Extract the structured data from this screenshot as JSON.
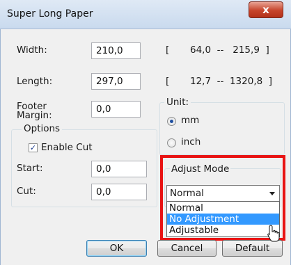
{
  "window": {
    "title": "Super Long Paper",
    "close_label": "x"
  },
  "fields": {
    "width": {
      "label": "Width:",
      "value": "210,0",
      "range_open": "[",
      "range_text": "64,0  --   215,9  ]"
    },
    "length": {
      "label": "Length:",
      "value": "297,0",
      "range_open": "[",
      "range_text": "12,7  --  1320,8  ]"
    },
    "footer_margin": {
      "label_line1": "Footer",
      "label_line2": "Margin:",
      "value": "0,0"
    }
  },
  "unit": {
    "title": "Unit:",
    "options": [
      "mm",
      "inch"
    ],
    "selected": "mm"
  },
  "options_group": {
    "title": "Options",
    "enable_cut_label": "Enable Cut",
    "enable_cut_checked": true,
    "check_mark": "✓",
    "start": {
      "label": "Start:",
      "value": "0,0"
    },
    "cut": {
      "label": "Cut:",
      "value": "0,0"
    }
  },
  "adjust_mode": {
    "title": "Adjust Mode",
    "selected": "Normal",
    "options": [
      "Normal",
      "No Adjustment",
      "Adjustable"
    ],
    "hovered": "No Adjustment"
  },
  "buttons": {
    "ok": "OK",
    "cancel": "Cancel",
    "default": "Default"
  },
  "colors": {
    "highlight_border": "#e81313",
    "selection": "#3399ff"
  }
}
